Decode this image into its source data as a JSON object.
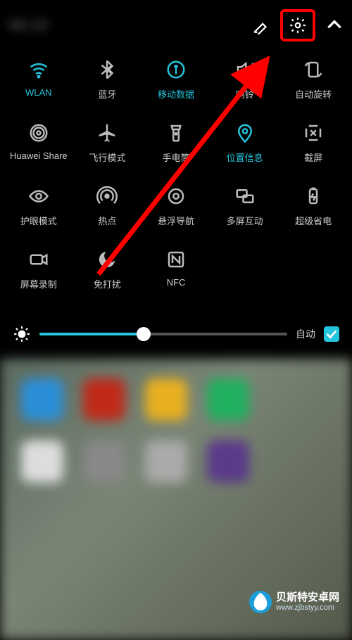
{
  "header": {
    "left_blurred_text": "08:15"
  },
  "tiles": [
    {
      "id": "wlan",
      "label": "WLAN",
      "active": true
    },
    {
      "id": "bluetooth",
      "label": "蓝牙",
      "active": false
    },
    {
      "id": "mobile-data",
      "label": "移动数据",
      "active": true
    },
    {
      "id": "sound",
      "label": "响铃",
      "active": false
    },
    {
      "id": "auto-rotate",
      "label": "自动旋转",
      "active": false
    },
    {
      "id": "huawei-share",
      "label": "Huawei Share",
      "active": false
    },
    {
      "id": "airplane",
      "label": "飞行模式",
      "active": false
    },
    {
      "id": "flashlight",
      "label": "手电筒",
      "active": false
    },
    {
      "id": "location",
      "label": "位置信息",
      "active": true
    },
    {
      "id": "screenshot",
      "label": "截屏",
      "active": false
    },
    {
      "id": "eye-comfort",
      "label": "护眼模式",
      "active": false
    },
    {
      "id": "hotspot",
      "label": "热点",
      "active": false
    },
    {
      "id": "float-nav",
      "label": "悬浮导航",
      "active": false
    },
    {
      "id": "multi-screen",
      "label": "多屏互动",
      "active": false
    },
    {
      "id": "power-save",
      "label": "超级省电",
      "active": false
    },
    {
      "id": "screen-record",
      "label": "屏幕录制",
      "active": false
    },
    {
      "id": "dnd",
      "label": "免打扰",
      "active": false
    },
    {
      "id": "nfc",
      "label": "NFC",
      "active": false
    }
  ],
  "brightness": {
    "value_percent": 42,
    "auto_label": "自动",
    "auto_checked": true
  },
  "watermark": {
    "name": "贝斯特安卓网",
    "url": "www.zjbstyy.com"
  },
  "colors": {
    "accent": "#23c4dc",
    "annotation_red": "#ff0000"
  }
}
